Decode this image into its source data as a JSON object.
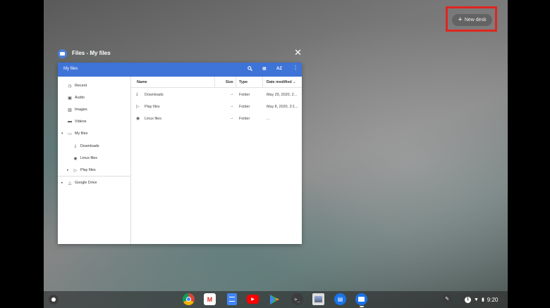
{
  "desktop": {
    "new_desk_label": "New desk",
    "new_desk_icon": "plus-icon",
    "highlight_color": "#e0261f"
  },
  "window": {
    "title": "Files - My files",
    "accent": "#3e73d8"
  },
  "toolbar": {
    "title": "My files",
    "sort_label": "AZ"
  },
  "sidebar": {
    "items": [
      {
        "label": "Recent",
        "icon": "clock-icon"
      },
      {
        "label": "Audio",
        "icon": "audio-icon"
      },
      {
        "label": "Images",
        "icon": "image-icon"
      },
      {
        "label": "Videos",
        "icon": "video-icon"
      },
      {
        "label": "My files",
        "icon": "laptop-icon"
      },
      {
        "label": "Downloads",
        "icon": "download-icon"
      },
      {
        "label": "Linux files",
        "icon": "linux-icon"
      },
      {
        "label": "Play files",
        "icon": "play-icon"
      },
      {
        "label": "Google Drive",
        "icon": "drive-icon"
      }
    ]
  },
  "file_list": {
    "columns": {
      "name": "Name",
      "size": "Size",
      "type": "Type",
      "date": "Date modified"
    },
    "rows": [
      {
        "name": "Downloads",
        "size": "--",
        "type": "Folder",
        "date": "May 29, 2020, 2...",
        "icon": "download-icon"
      },
      {
        "name": "Play files",
        "size": "--",
        "type": "Folder",
        "date": "May 8, 2020, 3:1...",
        "icon": "play-icon"
      },
      {
        "name": "Linux files",
        "size": "--",
        "type": "Folder",
        "date": "...",
        "icon": "linux-icon"
      }
    ]
  },
  "shelf": {
    "apps": [
      "Chrome",
      "Gmail",
      "Docs",
      "YouTube",
      "Play Store",
      "Terminal",
      "Screencast",
      "Messages",
      "Files"
    ],
    "notification_count": "1",
    "time": "9:20"
  }
}
